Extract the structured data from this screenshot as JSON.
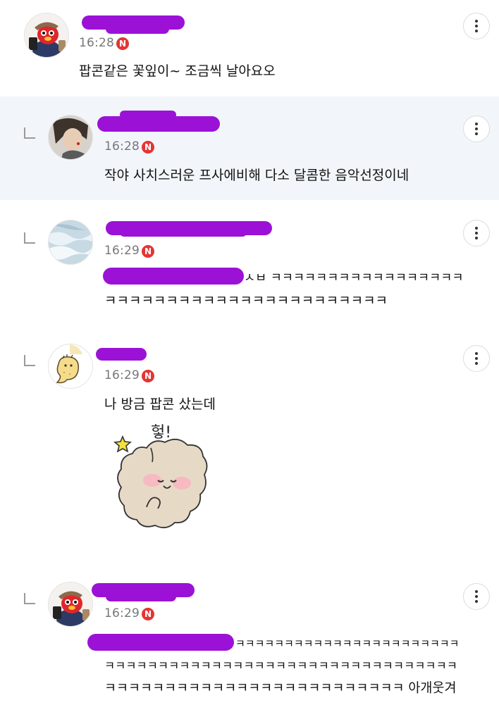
{
  "comments": [
    {
      "time": "16:28",
      "badge": "N",
      "text": "팝콘같은 꽃잎이~ 조금씩 날아요오",
      "highlight": false,
      "reply": false
    },
    {
      "time": "16:28",
      "badge": "N",
      "text": "작야 사치스러운 프사에비해 다소 달콤한 음악선정이네",
      "highlight": true,
      "reply": true
    },
    {
      "time": "16:29",
      "badge": "N",
      "text_line1": "ㅅㅂ ㅋㅋㅋㅋㅋㅋㅋㅋㅋㅋㅋㅋㅋㅋㅋㅋㅋ",
      "text_line2": "ㅋㅋㅋㅋㅋㅋㅋㅋㅋㅋㅋㅋㅋㅋㅋㅋㅋㅋㅋㅋㅋㅋㅋ",
      "highlight": false,
      "reply": true
    },
    {
      "time": "16:29",
      "badge": "N",
      "text": "나 방금 팝콘 샀는데",
      "sticker_text": "헣!",
      "highlight": false,
      "reply": true
    },
    {
      "time": "16:29",
      "badge": "N",
      "text_line1": "ㅋㅋㅋㅋㅋㅋㅋㅋㅋㅋㅋㅋㅋㅋㅋㅋㅋㅋㅋㅋㅋㅋㅋ",
      "text_line2": "ㅋㅋㅋㅋㅋㅋㅋㅋㅋㅋㅋㅋㅋㅋㅋㅋㅋㅋㅋㅋㅋㅋㅋㅋㅋㅋㅋㅋㅋㅋㅋㅋㅋ",
      "text_line3": "ㅋㅋㅋㅋㅋㅋㅋㅋㅋㅋㅋㅋㅋㅋㅋㅋㅋㅋㅋㅋㅋㅋㅋㅋㅋ 아개웃겨",
      "highlight": false,
      "reply": true
    }
  ],
  "icons": {
    "more": "more-vertical-icon",
    "reply": "reply-indent-icon",
    "new_badge": "new-badge-icon",
    "star": "star-icon"
  },
  "colors": {
    "redaction": "#9b12d6",
    "badge": "#e43434",
    "highlight_bg": "#f2f6fa"
  }
}
